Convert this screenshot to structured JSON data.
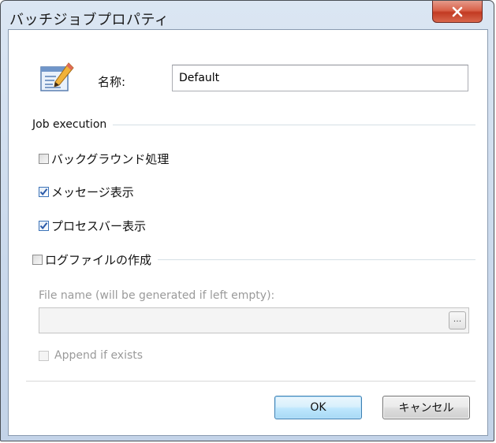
{
  "window": {
    "title": "バッチジョブプロパティ"
  },
  "name_section": {
    "label": "名称:",
    "value": "Default"
  },
  "job_execution": {
    "group_label": "Job execution",
    "options": [
      {
        "label": "バックグラウンド処理",
        "checked": false
      },
      {
        "label": "メッセージ表示",
        "checked": true
      },
      {
        "label": "プロセスバー表示",
        "checked": true
      }
    ]
  },
  "log_file": {
    "label": "ログファイルの作成",
    "checked": false,
    "file_name_label": "File name (will be generated if left empty):",
    "file_name_value": "",
    "browse_label": "...",
    "append_label": "Append if exists",
    "append_checked": false
  },
  "buttons": {
    "ok_label": "OK",
    "cancel_label": "キャンセル"
  },
  "colors": {
    "accent": "#3c7fb1",
    "close_button": "#c23a22",
    "check_mark": "#2a5aa8",
    "disabled_text": "#9a9a9a"
  },
  "icons": {
    "close": "close-icon",
    "name": "notepad-pencil-icon",
    "check": "check-mark-icon"
  }
}
